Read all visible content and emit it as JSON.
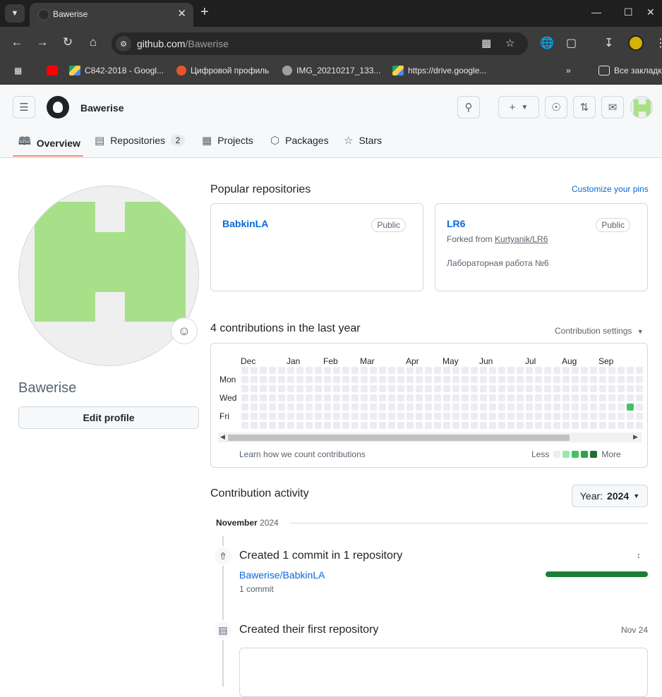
{
  "browser": {
    "tab_title": "Bawerise",
    "url_host": "github.com",
    "url_path": "/Bawerise",
    "bookmarks": [
      {
        "label": "C842-2018 - Googl...",
        "icon": "google-drive-icon"
      },
      {
        "label": "Цифровой профиль",
        "icon": "digital-profile-icon"
      },
      {
        "label": "IMG_20210217_133...",
        "icon": "globe-icon"
      },
      {
        "label": "https://drive.google...",
        "icon": "google-drive-icon"
      }
    ],
    "all_bookmarks_label": "Все закладк"
  },
  "header": {
    "username": "Bawerise",
    "tabs": [
      {
        "label": "Overview",
        "icon": "book-icon",
        "selected": true
      },
      {
        "label": "Repositories",
        "icon": "repo-icon",
        "counter": "2"
      },
      {
        "label": "Projects",
        "icon": "project-icon"
      },
      {
        "label": "Packages",
        "icon": "package-icon"
      },
      {
        "label": "Stars",
        "icon": "star-icon"
      }
    ]
  },
  "profile": {
    "name": "Bawerise",
    "edit_label": "Edit profile"
  },
  "popular": {
    "heading": "Popular repositories",
    "customize_label": "Customize your pins",
    "pins": [
      {
        "name": "BabkinLA",
        "visibility": "Public"
      },
      {
        "name": "LR6",
        "visibility": "Public",
        "forked_prefix": "Forked from",
        "forked_from": "Kurtyanik/LR6",
        "description": "Лабораторная работа №6"
      }
    ]
  },
  "contributions": {
    "heading": "4 contributions in the last year",
    "settings_label": "Contribution settings",
    "months": [
      "Dec",
      "Jan",
      "Feb",
      "Mar",
      "Apr",
      "May",
      "Jun",
      "Jul",
      "Aug",
      "Sep"
    ],
    "days": [
      "Mon",
      "Wed",
      "Fri"
    ],
    "learn_label": "Learn how we count contributions",
    "less_label": "Less",
    "more_label": "More",
    "colors": {
      "empty": "#ebedf0",
      "l1": "#9be9a8",
      "l2": "#40c463",
      "l3": "#30a14e",
      "l4": "#216e39"
    }
  },
  "activity": {
    "heading": "Contribution activity",
    "year_prefix": "Year:",
    "year": "2024",
    "month": "November",
    "month_year": "2024",
    "items": [
      {
        "title": "Created 1 commit in 1 repository",
        "repo": "Bawerise/BabkinLA",
        "count": "1 commit"
      },
      {
        "title": "Created their first repository",
        "date": "Nov 24"
      }
    ]
  }
}
